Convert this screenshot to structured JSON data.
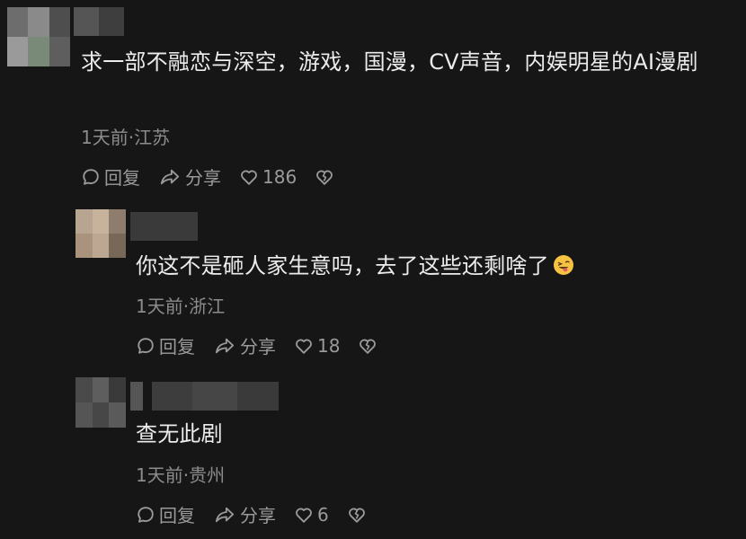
{
  "comments": [
    {
      "text": "求一部不融恋与深空，游戏，国漫，CV声音，内娱明星的AI漫剧",
      "meta": "1天前·江苏",
      "reply_label": "回复",
      "share_label": "分享",
      "like_count": "186"
    },
    {
      "text": "你这不是砸人家生意吗，去了这些还剩啥了",
      "emoji": "grinning-tongue-emoji",
      "meta": "1天前·浙江",
      "reply_label": "回复",
      "share_label": "分享",
      "like_count": "18"
    },
    {
      "text": "查无此剧",
      "meta": "1天前·贵州",
      "reply_label": "回复",
      "share_label": "分享",
      "like_count": "6"
    }
  ],
  "icons": {
    "reply": "comment-bubble-icon",
    "share": "share-arrow-icon",
    "like": "heart-outline-icon",
    "dislike": "broken-heart-icon"
  },
  "colors": {
    "background": "#161616",
    "text": "#ececec",
    "meta": "#8c8c8c",
    "actions": "#9a9a9a"
  }
}
